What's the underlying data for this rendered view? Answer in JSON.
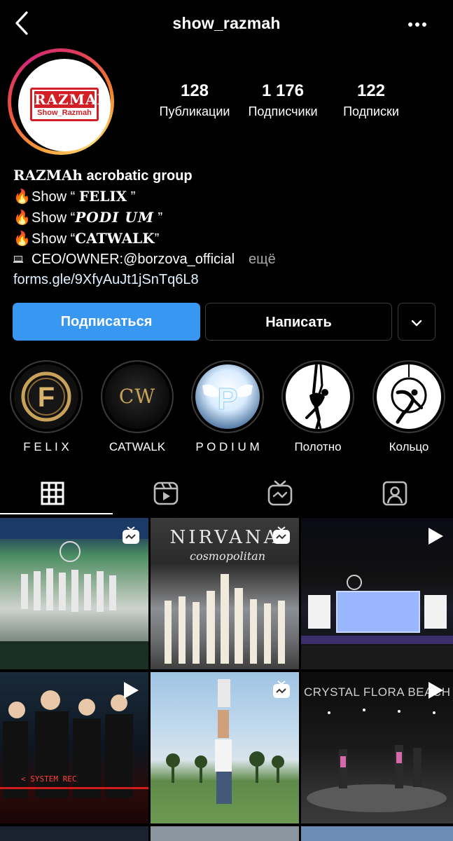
{
  "header": {
    "username": "show_razmah",
    "back_icon": "chevron-left-icon",
    "more_icon": "more-horizontal-icon"
  },
  "profile": {
    "avatar_logo_text": "RAZMAH",
    "avatar_logo_sub": "Show_Razmah",
    "stats": [
      {
        "value": "128",
        "label": "Публикации"
      },
      {
        "value": "1 176",
        "label": "Подписчики"
      },
      {
        "value": "122",
        "label": "Подписки"
      }
    ]
  },
  "bio": {
    "name_serif": "RAZMAh",
    "name_rest": " acrobatic group",
    "lines": [
      {
        "emoji": "🔥",
        "prefix": "Show “ ",
        "title": "FELIX",
        "suffix": " ”"
      },
      {
        "emoji": "🔥",
        "prefix": "Show “",
        "title": "PODI UM",
        "suffix": " ”"
      },
      {
        "emoji": "🔥",
        "prefix": "Show “",
        "title": "CATWALK",
        "suffix": "”"
      }
    ],
    "contact": "CEO/OWNER:@borzova_official",
    "more": "ещё",
    "url": "forms.gle/9XfyAuJt1jSnTq6L8"
  },
  "actions": {
    "follow": "Подписаться",
    "message": "Написать",
    "dropdown_icon": "chevron-down-icon"
  },
  "highlights": [
    {
      "label": "F E L I X"
    },
    {
      "label": "CATWALK"
    },
    {
      "label": "P O D I U M"
    },
    {
      "label": "Полотно"
    },
    {
      "label": "Кольцо"
    }
  ],
  "highlight_art": {
    "felix": "F",
    "catwalk": "CW",
    "podium": "P"
  },
  "tabs": [
    {
      "icon": "grid-icon",
      "active": true
    },
    {
      "icon": "reels-icon",
      "active": false
    },
    {
      "icon": "igtv-icon",
      "active": false
    },
    {
      "icon": "tagged-icon",
      "active": false
    }
  ],
  "grid": {
    "cells": [
      {
        "type": "igtv"
      },
      {
        "type": "igtv",
        "caption": "NIRVANA",
        "caption2": "cosmopolitan"
      },
      {
        "type": "reel"
      },
      {
        "type": "reel",
        "caption": "< SYSTEM REC"
      },
      {
        "type": "igtv"
      },
      {
        "type": "reel",
        "caption": "CRYSTAL FLORA BEACH"
      }
    ]
  },
  "colors": {
    "accent": "#3897f0",
    "logo_red": "#d21f26",
    "gold": "#c9a25a"
  }
}
